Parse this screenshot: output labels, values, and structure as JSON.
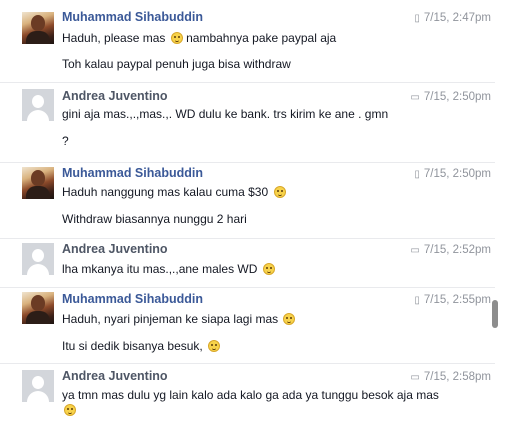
{
  "messages": [
    {
      "sender": "Muhammad Sihabuddin",
      "avatar": "profile-photo",
      "device_icon": "mobile-icon",
      "time": "7/15, 2:47pm",
      "lines": [
        "Haduh, please mas",
        "nambahnya pake paypal aja"
      ],
      "line2": "Toh kalau paypal penuh juga bisa withdraw"
    },
    {
      "sender": "Andrea Juventino",
      "avatar": "default-avatar",
      "device_icon": "chat-icon",
      "time": "7/15, 2:50pm",
      "line1": "gini aja mas.,.,mas.,. WD dulu ke bank. trs kirim ke ane . gmn",
      "line2": "?"
    },
    {
      "sender": "Muhammad Sihabuddin",
      "avatar": "profile-photo",
      "device_icon": "mobile-icon",
      "time": "7/15, 2:50pm",
      "line1": "Haduh nanggung mas kalau cuma $30",
      "line2": "Withdraw biasannya nunggu 2 hari"
    },
    {
      "sender": "Andrea Juventino",
      "avatar": "default-avatar",
      "device_icon": "chat-icon",
      "time": "7/15, 2:52pm",
      "line1": "lha mkanya itu mas.,.,ane males WD"
    },
    {
      "sender": "Muhammad Sihabuddin",
      "avatar": "profile-photo",
      "device_icon": "mobile-icon",
      "time": "7/15, 2:55pm",
      "line1": "Haduh, nyari pinjeman ke siapa lagi mas",
      "line2": "Itu si dedik bisanya besuk,"
    },
    {
      "sender": "Andrea Juventino",
      "avatar": "default-avatar",
      "device_icon": "chat-icon",
      "time": "7/15, 2:58pm",
      "line1": "ya tmn mas dulu yg lain kalo ada kalo ga ada ya tunggu besok aja mas"
    }
  ],
  "colors": {
    "sender_name": "#3b5998",
    "other_name": "#4e5665",
    "timestamp": "#90949c",
    "text": "#141823"
  }
}
